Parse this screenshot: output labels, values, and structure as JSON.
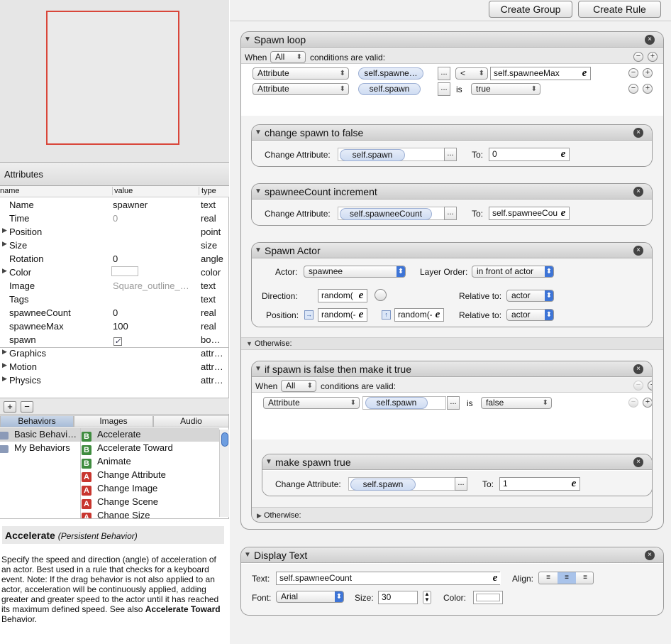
{
  "attributes": {
    "header": "Attributes",
    "columns": [
      "name",
      "value",
      "type"
    ],
    "rows": [
      {
        "name": "Name",
        "value": "spawner",
        "type": "text"
      },
      {
        "name": "Time",
        "value": "0",
        "type": "real"
      },
      {
        "name": "Position",
        "value": "",
        "type": "point"
      },
      {
        "name": "Size",
        "value": "",
        "type": "size"
      },
      {
        "name": "Rotation",
        "value": "0",
        "type": "angle"
      },
      {
        "name": "Color",
        "value": "",
        "type": "color"
      },
      {
        "name": "Image",
        "value": "Square_outline_…",
        "type": "text"
      },
      {
        "name": "Tags",
        "value": "",
        "type": "text"
      },
      {
        "name": "spawneeCount",
        "value": "0",
        "type": "real"
      },
      {
        "name": "spawneeMax",
        "value": "100",
        "type": "real"
      },
      {
        "name": "spawn",
        "value": "",
        "type": "bo…"
      }
    ],
    "groups": [
      {
        "name": "Graphics",
        "type": "attr…"
      },
      {
        "name": "Motion",
        "type": "attr…"
      },
      {
        "name": "Physics",
        "type": "attr…"
      }
    ]
  },
  "tabs": [
    "Behaviors",
    "Images",
    "Audio"
  ],
  "library": {
    "folders": [
      "Basic Behavi…",
      "My Behaviors"
    ],
    "behaviors": [
      {
        "badge": "B",
        "name": "Accelerate"
      },
      {
        "badge": "B",
        "name": "Accelerate Toward"
      },
      {
        "badge": "B",
        "name": "Animate"
      },
      {
        "badge": "A",
        "name": "Change Attribute"
      },
      {
        "badge": "A",
        "name": "Change Image"
      },
      {
        "badge": "A",
        "name": "Change Scene"
      },
      {
        "badge": "A",
        "name": "Change Size"
      }
    ]
  },
  "description": {
    "title": "Accelerate",
    "subtitle": "(Persistent Behavior)",
    "body_part1": "Specify the speed and direction (angle) of acceleration of an actor. Best used in a rule that checks for a keyboard event. Note: If the drag behavior is not also applied to an actor, acceleration will be continuously applied, adding greater and greater speed to the actor until it has reached its maximum defined speed. See also ",
    "body_bold": "Accelerate Toward",
    "body_part2": " Behavior."
  },
  "toolbar": {
    "create_group": "Create Group",
    "create_rule": "Create Rule"
  },
  "rule": {
    "title": "Spawn loop",
    "when": "When",
    "when_select": "All",
    "conditions_suffix": "conditions are valid:",
    "cond1": {
      "kind": "Attribute",
      "attr": "self.spawne…",
      "op": "<",
      "value": "self.spawneeMax"
    },
    "cond2": {
      "kind": "Attribute",
      "attr": "self.spawn",
      "is": "is",
      "value": "true"
    },
    "change_spawn": {
      "title": "change spawn to false",
      "label": "Change Attribute:",
      "attr": "self.spawn",
      "to_label": "To:",
      "to": "0"
    },
    "increment": {
      "title": "spawneeCount increment",
      "label": "Change Attribute:",
      "attr": "self.spawneeCount",
      "to_label": "To:",
      "to": "self.spawneeCou"
    },
    "spawn_actor": {
      "title": "Spawn Actor",
      "actor_label": "Actor:",
      "actor": "spawnee",
      "layer_label": "Layer Order:",
      "layer": "in front of actor",
      "direction_label": "Direction:",
      "direction": "random(",
      "relative1_label": "Relative to:",
      "relative1": "actor",
      "position_label": "Position:",
      "pos_x": "random(-",
      "pos_y": "random(-",
      "relative2_label": "Relative to:",
      "relative2": "actor"
    },
    "otherwise": "Otherwise:",
    "inner_rule": {
      "title": "if spawn is false then make it true",
      "when": "When",
      "when_select": "All",
      "conditions_suffix": "conditions are valid:",
      "cond": {
        "kind": "Attribute",
        "attr": "self.spawn",
        "is": "is",
        "value": "false"
      },
      "make_true": {
        "title": "make spawn true",
        "label": "Change Attribute:",
        "attr": "self.spawn",
        "to_label": "To:",
        "to": "1"
      },
      "otherwise": "Otherwise:"
    }
  },
  "display_text": {
    "title": "Display Text",
    "text_label": "Text:",
    "text": "self.spawneeCount",
    "align_label": "Align:",
    "font_label": "Font:",
    "font": "Arial",
    "size_label": "Size:",
    "size": "30",
    "color_label": "Color:"
  },
  "icons": {
    "close": "×",
    "add": "+",
    "remove": "−",
    "more": "...",
    "expression": "e"
  }
}
